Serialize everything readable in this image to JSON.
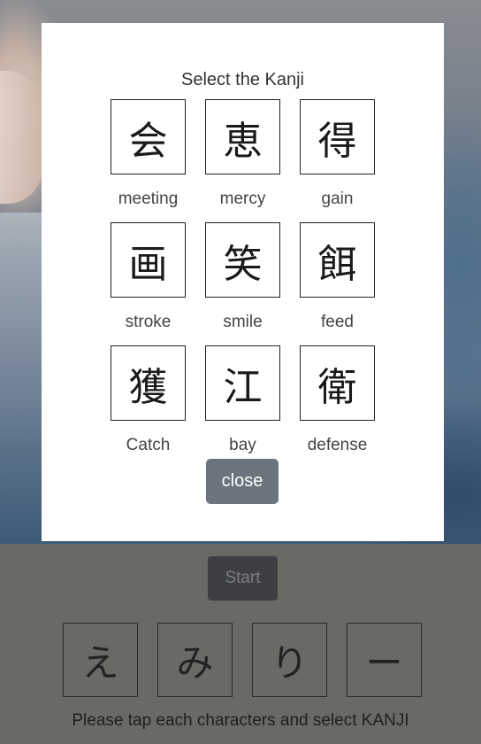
{
  "modal": {
    "title": "Select the Kanji",
    "options": [
      {
        "kanji": "会",
        "meaning": "meeting"
      },
      {
        "kanji": "恵",
        "meaning": "mercy"
      },
      {
        "kanji": "得",
        "meaning": "gain"
      },
      {
        "kanji": "画",
        "meaning": "stroke"
      },
      {
        "kanji": "笑",
        "meaning": "smile"
      },
      {
        "kanji": "餌",
        "meaning": "feed"
      },
      {
        "kanji": "獲",
        "meaning": "Catch"
      },
      {
        "kanji": "江",
        "meaning": "bay"
      },
      {
        "kanji": "衛",
        "meaning": "defense"
      }
    ],
    "close_label": "close"
  },
  "controls": {
    "start_label": "Start"
  },
  "reading": {
    "characters": [
      "え",
      "み",
      "り",
      "ー"
    ]
  },
  "instruction": "Please tap each characters and select KANJI",
  "colors": {
    "close_button": "#6c757d",
    "start_button": "#3d3f43",
    "overlay": "#6b6966"
  }
}
